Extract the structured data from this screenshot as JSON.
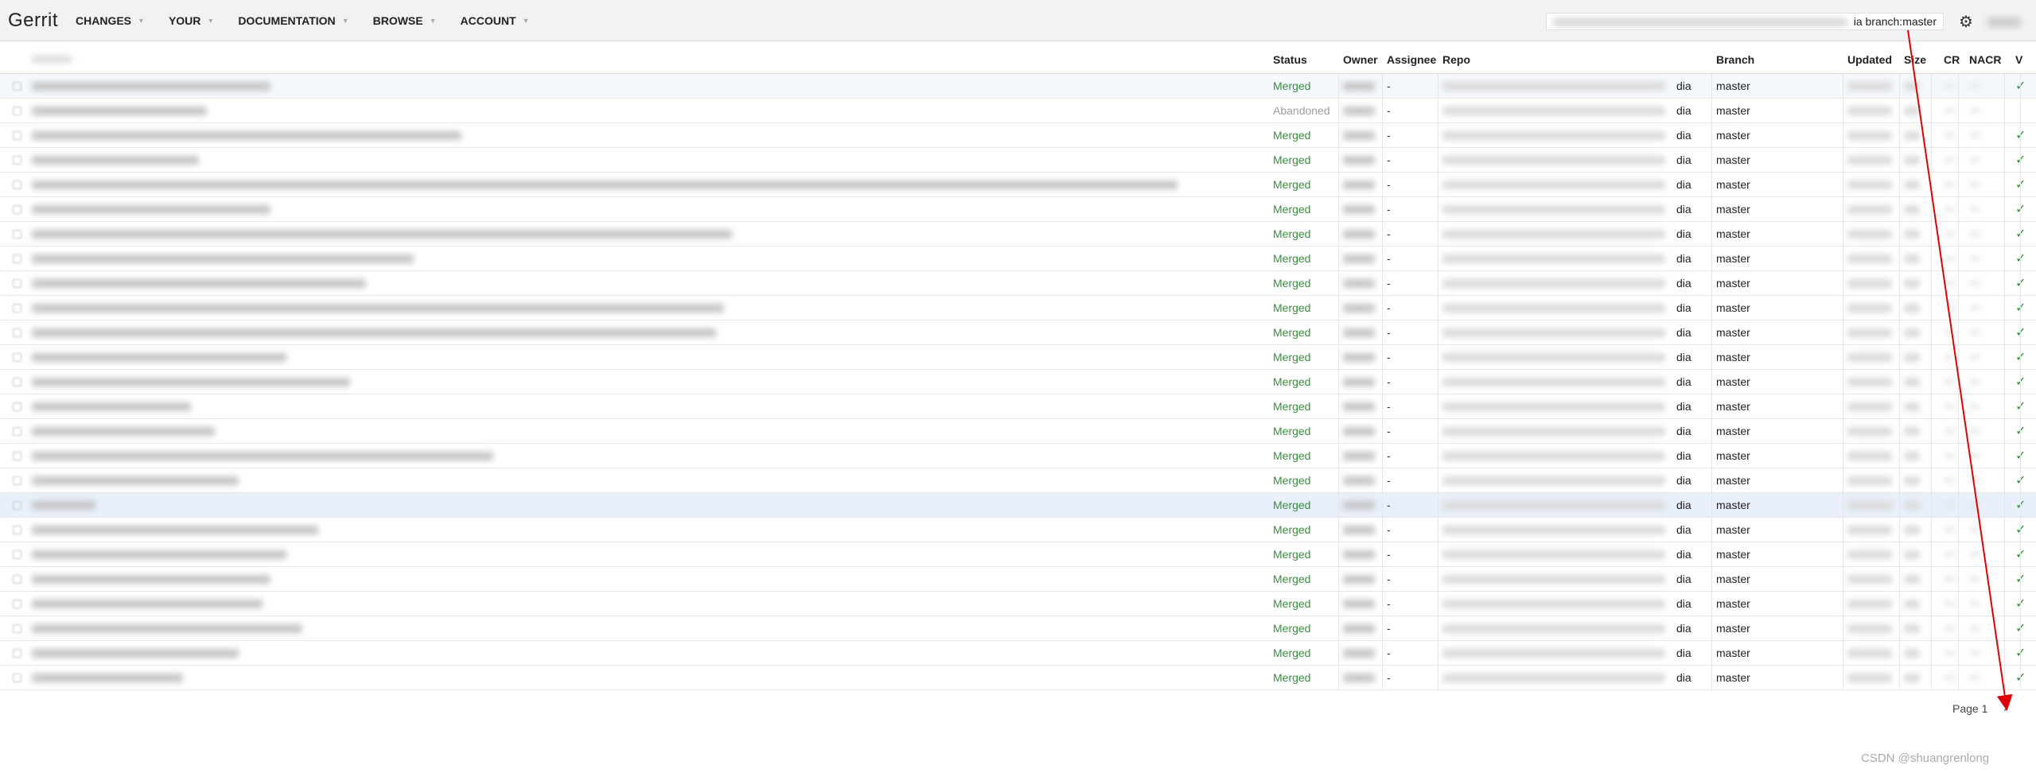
{
  "header": {
    "logo": "Gerrit",
    "menus": [
      {
        "label": "CHANGES"
      },
      {
        "label": "YOUR"
      },
      {
        "label": "DOCUMENTATION"
      },
      {
        "label": "BROWSE"
      },
      {
        "label": "ACCOUNT"
      }
    ],
    "search_value_visible": "ia branch:master",
    "settings_icon": "gear-icon"
  },
  "table": {
    "columns": [
      "Subject",
      "Status",
      "Owner",
      "Assignee",
      "Repo",
      "Branch",
      "Updated",
      "Size",
      "CR",
      "NACR",
      "V"
    ],
    "rows": [
      {
        "status": "Merged",
        "assignee": "-",
        "repo_suffix": "dia",
        "branch": "master",
        "v": "✓"
      },
      {
        "status": "Abandoned",
        "assignee": "-",
        "repo_suffix": "dia",
        "branch": "master",
        "v": ""
      },
      {
        "status": "Merged",
        "assignee": "-",
        "repo_suffix": "dia",
        "branch": "master",
        "v": "✓"
      },
      {
        "status": "Merged",
        "assignee": "-",
        "repo_suffix": "dia",
        "branch": "master",
        "v": "✓"
      },
      {
        "status": "Merged",
        "assignee": "-",
        "repo_suffix": "dia",
        "branch": "master",
        "v": "✓"
      },
      {
        "status": "Merged",
        "assignee": "-",
        "repo_suffix": "dia",
        "branch": "master",
        "v": "✓"
      },
      {
        "status": "Merged",
        "assignee": "-",
        "repo_suffix": "dia",
        "branch": "master",
        "v": "✓"
      },
      {
        "status": "Merged",
        "assignee": "-",
        "repo_suffix": "dia",
        "branch": "master",
        "v": "✓"
      },
      {
        "status": "Merged",
        "assignee": "-",
        "repo_suffix": "dia",
        "branch": "master",
        "v": "✓"
      },
      {
        "status": "Merged",
        "assignee": "-",
        "repo_suffix": "dia",
        "branch": "master",
        "v": "✓"
      },
      {
        "status": "Merged",
        "assignee": "-",
        "repo_suffix": "dia",
        "branch": "master",
        "v": "✓"
      },
      {
        "status": "Merged",
        "assignee": "-",
        "repo_suffix": "dia",
        "branch": "master",
        "v": "✓"
      },
      {
        "status": "Merged",
        "assignee": "-",
        "repo_suffix": "dia",
        "branch": "master",
        "v": "✓"
      },
      {
        "status": "Merged",
        "assignee": "-",
        "repo_suffix": "dia",
        "branch": "master",
        "v": "✓"
      },
      {
        "status": "Merged",
        "assignee": "-",
        "repo_suffix": "dia",
        "branch": "master",
        "v": "✓"
      },
      {
        "status": "Merged",
        "assignee": "-",
        "repo_suffix": "dia",
        "branch": "master",
        "v": "✓"
      },
      {
        "status": "Merged",
        "assignee": "-",
        "repo_suffix": "dia",
        "branch": "master",
        "v": "✓"
      },
      {
        "status": "Merged",
        "assignee": "-",
        "repo_suffix": "dia",
        "branch": "master",
        "v": "✓"
      },
      {
        "status": "Merged",
        "assignee": "-",
        "repo_suffix": "dia",
        "branch": "master",
        "v": "✓"
      },
      {
        "status": "Merged",
        "assignee": "-",
        "repo_suffix": "dia",
        "branch": "master",
        "v": "✓"
      },
      {
        "status": "Merged",
        "assignee": "-",
        "repo_suffix": "dia",
        "branch": "master",
        "v": "✓"
      },
      {
        "status": "Merged",
        "assignee": "-",
        "repo_suffix": "dia",
        "branch": "master",
        "v": "✓"
      },
      {
        "status": "Merged",
        "assignee": "-",
        "repo_suffix": "dia",
        "branch": "master",
        "v": "✓"
      },
      {
        "status": "Merged",
        "assignee": "-",
        "repo_suffix": "dia",
        "branch": "master",
        "v": "✓"
      },
      {
        "status": "Merged",
        "assignee": "-",
        "repo_suffix": "dia",
        "branch": "master",
        "v": "✓"
      }
    ]
  },
  "pagination": {
    "page_label": "Page 1",
    "next_icon": "chevron-right-icon"
  },
  "watermark": "CSDN @shuangrenlong",
  "colors": {
    "merged": "#388e3c",
    "abandoned": "#9e9e9e",
    "annotation_arrow": "#e00000",
    "highlight_row": "#e9f0fb"
  }
}
